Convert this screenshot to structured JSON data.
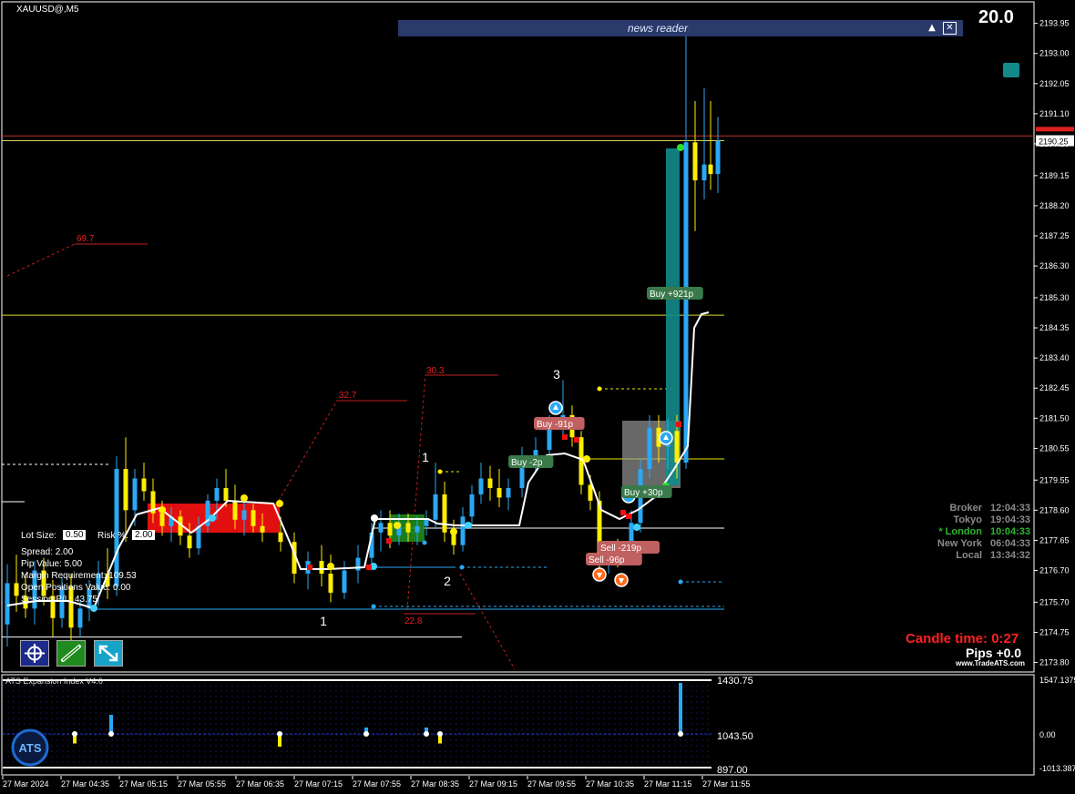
{
  "header": {
    "symbol": "XAUUSD@,M5",
    "top_value": "20.0"
  },
  "news": {
    "title": "news reader",
    "up_icon": "up-arrow-icon",
    "close_icon": "close-icon"
  },
  "price_axis": {
    "ticks": [
      "2193.95",
      "2193.00",
      "2192.05",
      "2191.10",
      "2190.15",
      "2189.15",
      "2188.20",
      "2187.25",
      "2186.30",
      "2185.30",
      "2184.35",
      "2183.40",
      "2182.45",
      "2181.50",
      "2180.55",
      "2179.55",
      "2178.60",
      "2177.65",
      "2176.70",
      "2175.70",
      "2174.75",
      "2173.80"
    ],
    "current_price": "2190.25",
    "current_color": "#ffffff"
  },
  "time_axis": [
    "27 Mar 2024",
    "27 Mar 04:35",
    "27 Mar 05:15",
    "27 Mar 05:55",
    "27 Mar 06:35",
    "27 Mar 07:15",
    "27 Mar 07:55",
    "27 Mar 08:35",
    "27 Mar 09:15",
    "27 Mar 09:55",
    "27 Mar 10:35",
    "27 Mar 11:15",
    "27 Mar 11:55"
  ],
  "chart_data": {
    "type": "candlestick",
    "ylim": [
      2173.5,
      2194.6
    ],
    "price_points": [
      {
        "t": 0,
        "o": 2175.0,
        "h": 2176.9,
        "l": 2174.3,
        "c": 2176.3
      },
      {
        "t": 10,
        "o": 2176.3,
        "h": 2177.2,
        "l": 2175.4,
        "c": 2175.9
      },
      {
        "t": 20,
        "o": 2175.9,
        "h": 2176.6,
        "l": 2175.2,
        "c": 2175.5
      },
      {
        "t": 30,
        "o": 2175.5,
        "h": 2177.0,
        "l": 2175.0,
        "c": 2176.7
      },
      {
        "t": 40,
        "o": 2176.7,
        "h": 2177.1,
        "l": 2175.6,
        "c": 2175.9
      },
      {
        "t": 50,
        "o": 2175.9,
        "h": 2176.4,
        "l": 2174.6,
        "c": 2175.2
      },
      {
        "t": 60,
        "o": 2175.2,
        "h": 2176.5,
        "l": 2174.9,
        "c": 2176.2
      },
      {
        "t": 70,
        "o": 2176.2,
        "h": 2176.6,
        "l": 2174.4,
        "c": 2174.9
      },
      {
        "t": 80,
        "o": 2174.9,
        "h": 2175.8,
        "l": 2174.6,
        "c": 2175.5
      },
      {
        "t": 90,
        "o": 2175.5,
        "h": 2176.4,
        "l": 2175.1,
        "c": 2176.1
      },
      {
        "t": 100,
        "o": 2176.1,
        "h": 2177.0,
        "l": 2175.6,
        "c": 2176.6
      },
      {
        "t": 110,
        "o": 2176.6,
        "h": 2177.4,
        "l": 2175.8,
        "c": 2176.2
      },
      {
        "t": 120,
        "o": 2176.2,
        "h": 2180.3,
        "l": 2175.9,
        "c": 2179.9
      },
      {
        "t": 130,
        "o": 2179.9,
        "h": 2180.9,
        "l": 2177.6,
        "c": 2178.6
      },
      {
        "t": 140,
        "o": 2178.6,
        "h": 2179.9,
        "l": 2178.1,
        "c": 2179.6
      },
      {
        "t": 150,
        "o": 2179.6,
        "h": 2180.1,
        "l": 2178.9,
        "c": 2179.2
      },
      {
        "t": 160,
        "o": 2179.2,
        "h": 2179.6,
        "l": 2178.2,
        "c": 2178.5
      },
      {
        "t": 170,
        "o": 2178.5,
        "h": 2178.9,
        "l": 2177.8,
        "c": 2178.1
      },
      {
        "t": 180,
        "o": 2178.1,
        "h": 2178.7,
        "l": 2177.6,
        "c": 2178.4
      },
      {
        "t": 190,
        "o": 2178.4,
        "h": 2178.6,
        "l": 2177.5,
        "c": 2177.8
      },
      {
        "t": 200,
        "o": 2177.8,
        "h": 2178.2,
        "l": 2177.1,
        "c": 2177.4
      },
      {
        "t": 210,
        "o": 2177.4,
        "h": 2178.4,
        "l": 2177.2,
        "c": 2178.1
      },
      {
        "t": 220,
        "o": 2178.1,
        "h": 2179.1,
        "l": 2177.9,
        "c": 2178.9
      },
      {
        "t": 230,
        "o": 2178.9,
        "h": 2179.6,
        "l": 2178.3,
        "c": 2179.3
      },
      {
        "t": 240,
        "o": 2179.3,
        "h": 2179.9,
        "l": 2178.7,
        "c": 2178.9
      },
      {
        "t": 250,
        "o": 2178.9,
        "h": 2179.4,
        "l": 2178.0,
        "c": 2178.3
      },
      {
        "t": 260,
        "o": 2178.3,
        "h": 2178.9,
        "l": 2177.8,
        "c": 2178.6
      },
      {
        "t": 270,
        "o": 2178.6,
        "h": 2178.8,
        "l": 2177.9,
        "c": 2178.1
      },
      {
        "t": 280,
        "o": 2178.1,
        "h": 2178.5,
        "l": 2177.6,
        "c": 2177.9
      },
      {
        "t": 300,
        "o": 2177.9,
        "h": 2178.4,
        "l": 2177.3,
        "c": 2177.6
      },
      {
        "t": 315,
        "o": 2177.6,
        "h": 2177.9,
        "l": 2176.3,
        "c": 2176.6
      },
      {
        "t": 330,
        "o": 2176.6,
        "h": 2177.3,
        "l": 2176.1,
        "c": 2177.0
      },
      {
        "t": 345,
        "o": 2177.0,
        "h": 2177.5,
        "l": 2176.2,
        "c": 2176.6
      },
      {
        "t": 355,
        "o": 2176.6,
        "h": 2177.2,
        "l": 2175.7,
        "c": 2176.0
      },
      {
        "t": 370,
        "o": 2176.0,
        "h": 2177.0,
        "l": 2175.8,
        "c": 2176.7
      },
      {
        "t": 385,
        "o": 2176.7,
        "h": 2177.5,
        "l": 2176.3,
        "c": 2177.1
      },
      {
        "t": 400,
        "o": 2177.1,
        "h": 2178.2,
        "l": 2176.8,
        "c": 2177.9
      },
      {
        "t": 410,
        "o": 2177.9,
        "h": 2178.6,
        "l": 2177.3,
        "c": 2178.2
      },
      {
        "t": 420,
        "o": 2178.2,
        "h": 2178.6,
        "l": 2177.4,
        "c": 2177.8
      },
      {
        "t": 430,
        "o": 2177.8,
        "h": 2178.5,
        "l": 2177.5,
        "c": 2178.2
      },
      {
        "t": 440,
        "o": 2178.2,
        "h": 2178.5,
        "l": 2177.6,
        "c": 2177.9
      },
      {
        "t": 450,
        "o": 2177.9,
        "h": 2178.4,
        "l": 2177.5,
        "c": 2178.1
      },
      {
        "t": 460,
        "o": 2178.1,
        "h": 2178.6,
        "l": 2177.8,
        "c": 2178.3
      },
      {
        "t": 470,
        "o": 2178.3,
        "h": 2180.1,
        "l": 2178.0,
        "c": 2179.1
      },
      {
        "t": 480,
        "o": 2179.1,
        "h": 2179.5,
        "l": 2177.6,
        "c": 2177.9
      },
      {
        "t": 490,
        "o": 2177.9,
        "h": 2178.3,
        "l": 2177.2,
        "c": 2177.5
      },
      {
        "t": 500,
        "o": 2177.5,
        "h": 2178.7,
        "l": 2177.3,
        "c": 2178.4
      },
      {
        "t": 510,
        "o": 2178.4,
        "h": 2179.4,
        "l": 2178.1,
        "c": 2179.1
      },
      {
        "t": 520,
        "o": 2179.1,
        "h": 2180.1,
        "l": 2178.8,
        "c": 2179.6
      },
      {
        "t": 530,
        "o": 2179.6,
        "h": 2180.0,
        "l": 2178.9,
        "c": 2179.3
      },
      {
        "t": 540,
        "o": 2179.3,
        "h": 2179.9,
        "l": 2178.7,
        "c": 2179.0
      },
      {
        "t": 550,
        "o": 2179.0,
        "h": 2179.6,
        "l": 2178.6,
        "c": 2179.3
      },
      {
        "t": 565,
        "o": 2179.3,
        "h": 2180.6,
        "l": 2179.0,
        "c": 2180.2
      },
      {
        "t": 580,
        "o": 2180.2,
        "h": 2180.9,
        "l": 2179.8,
        "c": 2180.5
      },
      {
        "t": 595,
        "o": 2180.5,
        "h": 2181.6,
        "l": 2180.1,
        "c": 2181.3
      },
      {
        "t": 610,
        "o": 2181.3,
        "h": 2182.7,
        "l": 2180.9,
        "c": 2181.6
      },
      {
        "t": 620,
        "o": 2181.6,
        "h": 2181.9,
        "l": 2180.6,
        "c": 2180.9
      },
      {
        "t": 630,
        "o": 2180.9,
        "h": 2181.1,
        "l": 2179.1,
        "c": 2179.4
      },
      {
        "t": 640,
        "o": 2179.4,
        "h": 2179.7,
        "l": 2178.6,
        "c": 2178.9
      },
      {
        "t": 650,
        "o": 2178.9,
        "h": 2179.2,
        "l": 2176.7,
        "c": 2177.0
      },
      {
        "t": 660,
        "o": 2177.0,
        "h": 2177.6,
        "l": 2176.6,
        "c": 2177.3
      },
      {
        "t": 670,
        "o": 2177.3,
        "h": 2177.7,
        "l": 2176.8,
        "c": 2177.1
      },
      {
        "t": 685,
        "o": 2177.1,
        "h": 2178.6,
        "l": 2176.9,
        "c": 2178.2
      },
      {
        "t": 695,
        "o": 2178.2,
        "h": 2180.2,
        "l": 2177.9,
        "c": 2179.9
      },
      {
        "t": 705,
        "o": 2179.9,
        "h": 2181.6,
        "l": 2179.6,
        "c": 2181.2
      },
      {
        "t": 715,
        "o": 2181.2,
        "h": 2181.6,
        "l": 2180.1,
        "c": 2180.6
      },
      {
        "t": 725,
        "o": 2180.6,
        "h": 2181.5,
        "l": 2179.9,
        "c": 2181.1
      },
      {
        "t": 735,
        "o": 2181.1,
        "h": 2181.6,
        "l": 2179.6,
        "c": 2180.1
      },
      {
        "t": 745,
        "o": 2180.1,
        "h": 2193.95,
        "l": 2179.9,
        "c": 2190.2
      },
      {
        "t": 755,
        "o": 2190.2,
        "h": 2191.5,
        "l": 2187.4,
        "c": 2189.0
      },
      {
        "t": 765,
        "o": 2189.0,
        "h": 2191.9,
        "l": 2188.4,
        "c": 2189.5
      },
      {
        "t": 772,
        "o": 2189.5,
        "h": 2191.5,
        "l": 2188.7,
        "c": 2189.2
      },
      {
        "t": 780,
        "o": 2189.2,
        "h": 2191.0,
        "l": 2188.6,
        "c": 2190.25
      }
    ],
    "levels": {
      "red_line": 2190.4,
      "yellow_line": 2190.25,
      "yellow_mid": 2184.75,
      "white_low": 2174.6
    }
  },
  "annotations": {
    "num_labels": [
      "1",
      "2",
      "3",
      "1"
    ],
    "red_labels": [
      "69.7",
      "32.7",
      "30.3",
      "22.8"
    ],
    "trade_labels": [
      "Buy +921p",
      "Buy -91p",
      "Buy -2p",
      "Buy +30p",
      "Sell -219p",
      "Sell -96p"
    ]
  },
  "info_panel": {
    "lot_label": "Lot Size:",
    "lot_value": "0.50",
    "risk_label": "Risk %:",
    "risk_value": "2.00",
    "spread": "Spread: 2.00",
    "pip_value": "Pip Value: 5.00",
    "margin": "Margin Requirement: 109.53",
    "open_positions": "Open Positions Value: 0.00",
    "session_pl": "Session P/L: 43.75"
  },
  "clocks": [
    {
      "name": "Broker",
      "time": "12:04:33",
      "color": "#8a8a8a"
    },
    {
      "name": "Tokyo",
      "time": "19:04:33",
      "color": "#8a8a8a"
    },
    {
      "name": "* London",
      "time": "10:04:33",
      "color": "#2fb52f"
    },
    {
      "name": "New York",
      "time": "06:04:33",
      "color": "#8a8a8a"
    },
    {
      "name": "Local",
      "time": "13:34:32",
      "color": "#8a8a8a"
    }
  ],
  "candle_time": {
    "label": "Candle time:",
    "value": "0:27"
  },
  "pips": "Pips +0.0",
  "site": "www.TradeATS.com",
  "indicator": {
    "title": "ATS Expansion Index V4.0",
    "levels": [
      "1430.75",
      "1043.50",
      "897.00"
    ],
    "axis_ticks": [
      "1547.1375",
      "0.00",
      "-1013.3875"
    ],
    "logo": "ATS",
    "bars": [
      {
        "t": 82,
        "v": -0.3,
        "color": "#ffee00"
      },
      {
        "t": 122,
        "v": 0.6,
        "color": "#2aa8f5"
      },
      {
        "t": 307,
        "v": -0.4,
        "color": "#ffee00"
      },
      {
        "t": 402,
        "v": 0.2,
        "color": "#2aa8f5"
      },
      {
        "t": 468,
        "v": 0.2,
        "color": "#2aa8f5"
      },
      {
        "t": 483,
        "v": -0.3,
        "color": "#ffee00"
      },
      {
        "t": 747,
        "v": 1.6,
        "color": "#2aa8f5"
      }
    ]
  },
  "toolbar": [
    {
      "name": "crosshair-tool",
      "color": "#1c2a8c"
    },
    {
      "name": "link-tool",
      "color": "#1f8b1f"
    },
    {
      "name": "zoom-tool",
      "color": "#17a2c7"
    }
  ]
}
